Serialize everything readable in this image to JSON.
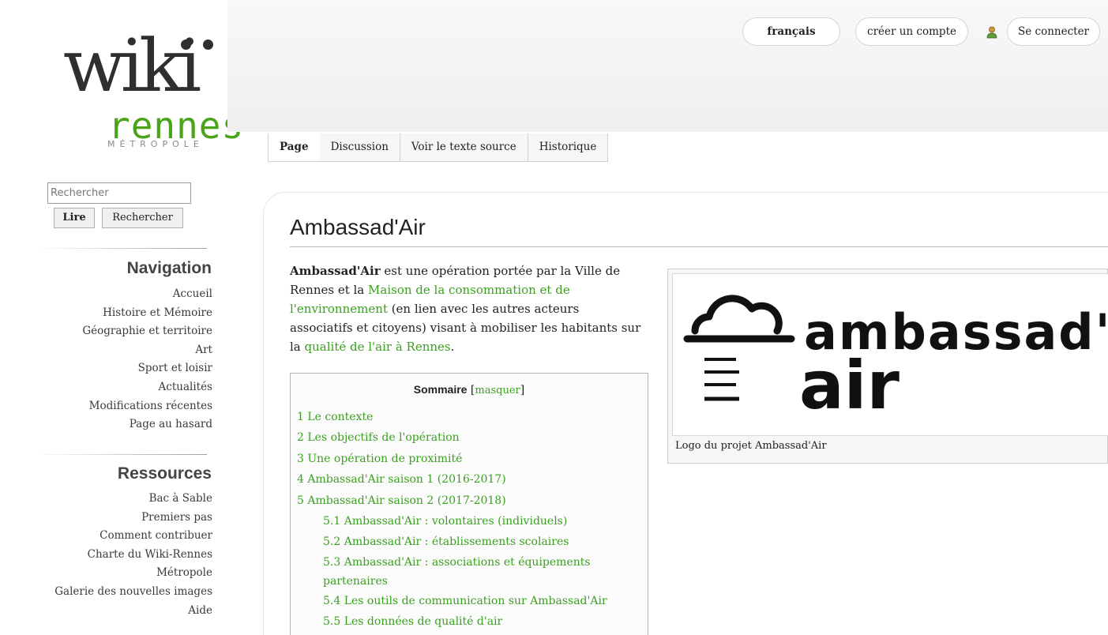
{
  "logo": {
    "wordmark": "wiki",
    "city": "rennes",
    "region": "MÉTROPOLE"
  },
  "search": {
    "placeholder": "Rechercher",
    "read_label": "Lire",
    "search_label": "Rechercher"
  },
  "navigation": {
    "title": "Navigation",
    "items": [
      "Accueil",
      "Histoire et Mémoire",
      "Géographie et territoire",
      "Art",
      "Sport et loisir",
      "Actualités",
      "Modifications récentes",
      "Page au hasard"
    ]
  },
  "resources": {
    "title": "Ressources",
    "items": [
      "Bac à Sable",
      "Premiers pas",
      "Comment contribuer",
      "Charte du Wiki-Rennes",
      "Métropole",
      "Galerie des nouvelles images",
      "Aide"
    ]
  },
  "header": {
    "language": "français",
    "create_account": "créer un compte",
    "login": "Se connecter"
  },
  "tabs": [
    "Page",
    "Discussion",
    "Voir le texte source",
    "Historique"
  ],
  "article": {
    "title": "Ambassad'Air",
    "intro": {
      "bold": "Ambassad'Air",
      "text1": " est une opération portée par la Ville de Rennes et la ",
      "link1": "Maison de la consommation et de l'environnement",
      "text2": " (en lien avec les autres acteurs associatifs et citoyens) visant à mobiliser les habitants sur la ",
      "link2": "qualité de l'air à Rennes",
      "text3": "."
    },
    "toc": {
      "title": "Sommaire",
      "toggle": "masquer",
      "items": [
        "1 Le contexte",
        "2 Les objectifs de l'opération",
        "3 Une opération de proximité",
        "4 Ambassad'Air saison 1 (2016-2017)",
        "5 Ambassad'Air saison 2 (2017-2018)",
        "5.1 Ambassad'Air : volontaires (individuels)",
        "5.2 Ambassad'Air : établissements scolaires",
        "5.3 Ambassad'Air : associations et équipements partenaires",
        "5.4 Les outils de communication sur Ambassad'Air",
        "5.5 Les données de qualité d'air"
      ]
    },
    "image": {
      "logo_text_top": "ambassad'",
      "logo_text_bottom": "air",
      "caption": "Logo du projet Ambassad'Air"
    }
  },
  "colors": {
    "link": "#3ba020",
    "logo_green": "#4aa41a",
    "text": "#222222"
  }
}
